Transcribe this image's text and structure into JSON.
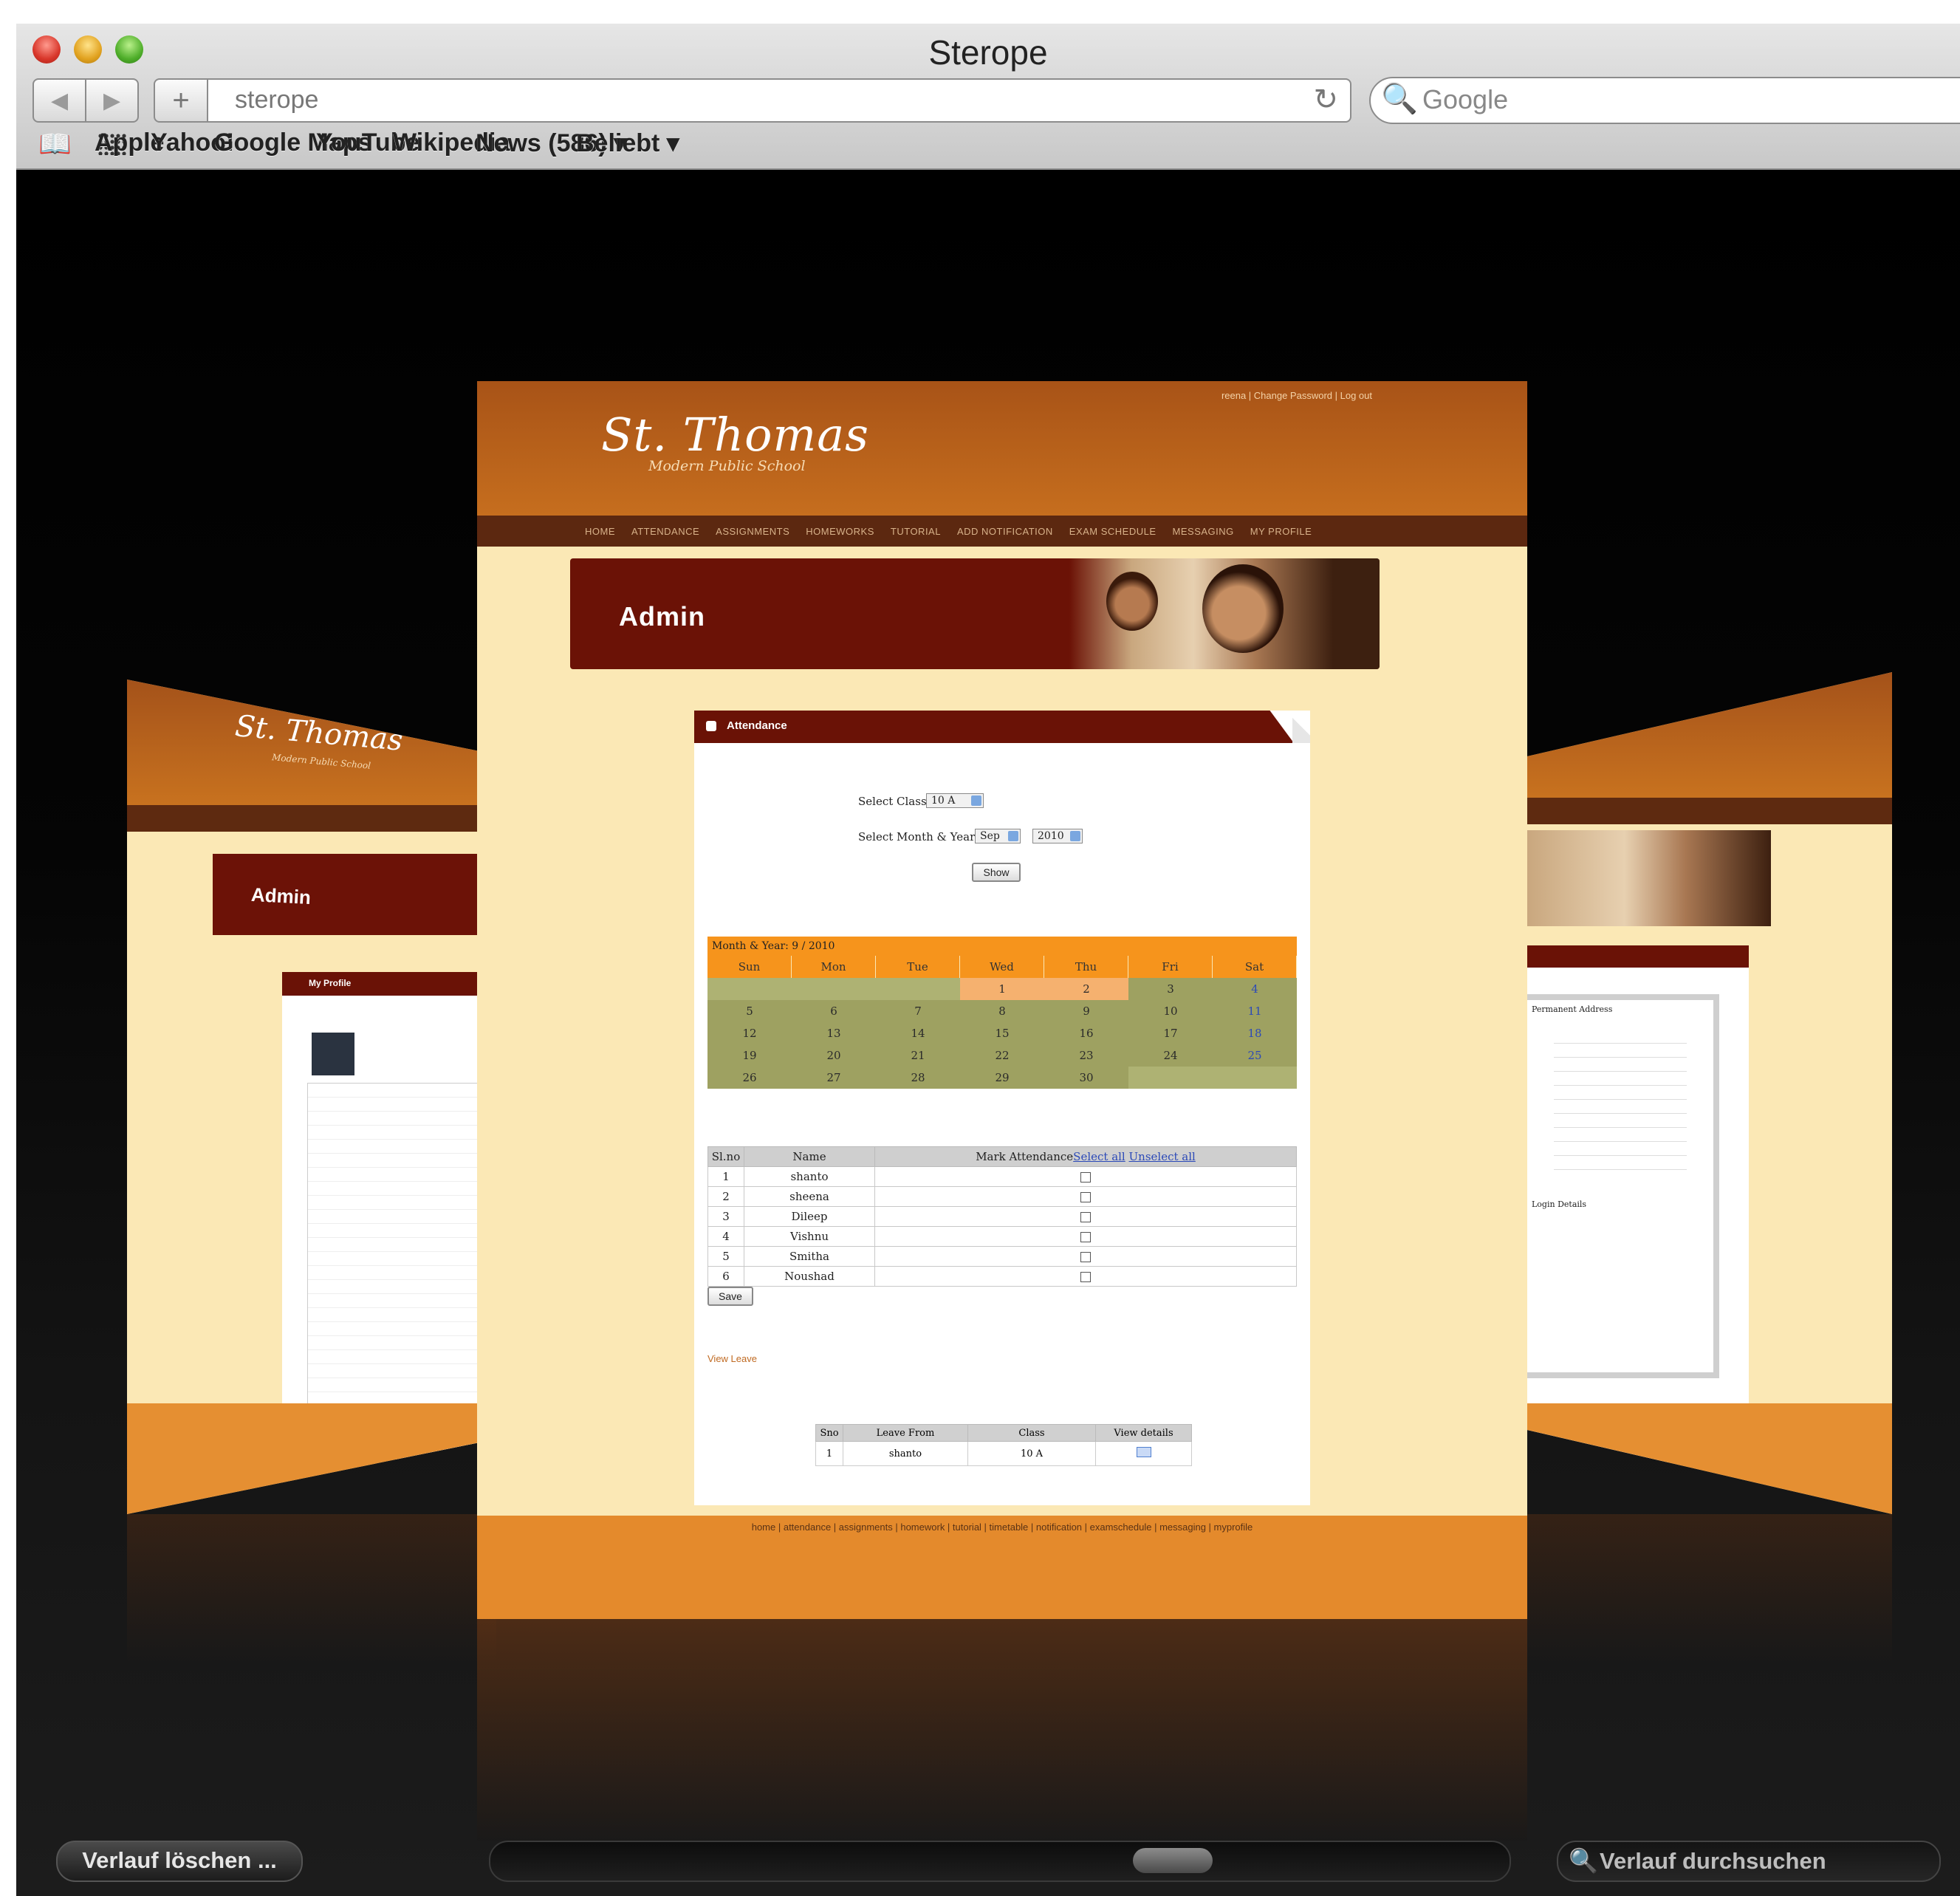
{
  "window": {
    "title": "Sterope"
  },
  "toolbar": {
    "back_icon": "◀",
    "forward_icon": "▶",
    "add_icon": "+",
    "url": "sterope",
    "reload_icon": "↻",
    "search_placeholder": "Google",
    "search_icon": "🔍"
  },
  "bookmarks": {
    "book_icon": "📖",
    "items": [
      "Apple",
      "Yahoo!",
      "Google Maps",
      "YouTube",
      "Wikipedia",
      "News (586) ▾",
      "Beliebt ▾"
    ]
  },
  "site": {
    "logo": "St. Thomas",
    "logo_sub": "Modern Public School",
    "top_links": "reena | Change Password | Log out",
    "nav": [
      "HOME",
      "ATTENDANCE",
      "ASSIGNMENTS",
      "HOMEWORKS",
      "TUTORIAL",
      "ADD NOTIFICATION",
      "EXAM SCHEDULE",
      "MESSAGING",
      "MY PROFILE"
    ],
    "banner_title": "Admin",
    "card_title": "Attendance",
    "select_class_label": "Select Class",
    "select_class_value": "10 A",
    "select_month_label": "Select Month & Year",
    "month_value": "Sep",
    "year_value": "2010",
    "show_button": "Show",
    "calendar": {
      "caption": "Month & Year: 9 / 2010",
      "days": [
        "Sun",
        "Mon",
        "Tue",
        "Wed",
        "Thu",
        "Fri",
        "Sat"
      ],
      "weeks": [
        [
          "",
          "",
          "",
          "1",
          "2",
          "3",
          "4"
        ],
        [
          "5",
          "6",
          "7",
          "8",
          "9",
          "10",
          "11"
        ],
        [
          "12",
          "13",
          "14",
          "15",
          "16",
          "17",
          "18"
        ],
        [
          "19",
          "20",
          "21",
          "22",
          "23",
          "24",
          "25"
        ],
        [
          "26",
          "27",
          "28",
          "29",
          "30",
          "",
          ""
        ]
      ]
    },
    "attendance": {
      "col_slno": "Sl.no",
      "col_name": "Name",
      "col_mark": "Mark Attendance",
      "select_all": "Select all",
      "unselect_all": "Unselect all",
      "rows": [
        {
          "no": "1",
          "name": "shanto"
        },
        {
          "no": "2",
          "name": "sheena"
        },
        {
          "no": "3",
          "name": "Dileep"
        },
        {
          "no": "4",
          "name": "Vishnu"
        },
        {
          "no": "5",
          "name": "Smitha"
        },
        {
          "no": "6",
          "name": "Noushad"
        }
      ]
    },
    "save_button": "Save",
    "view_leave": "View Leave",
    "leave_table": {
      "headers": [
        "Sno",
        "Leave From",
        "Class",
        "View details"
      ],
      "row": [
        "1",
        "shanto",
        "10 A",
        ""
      ]
    },
    "footer_links": "home | attendance | assignments | homework | tutorial | timetable | notification | examschedule | messaging | myprofile"
  },
  "side_left": {
    "logo": "St. Thomas",
    "logo_sub": "Modern Public School",
    "banner": "Admin",
    "card": "My Profile"
  },
  "side_right": {
    "section1": "Permanent Address",
    "section2": "Login Details"
  },
  "bottom": {
    "clear_history": "Verlauf löschen ...",
    "search_history": "Verlauf durchsuchen",
    "search_icon": "🔍"
  }
}
